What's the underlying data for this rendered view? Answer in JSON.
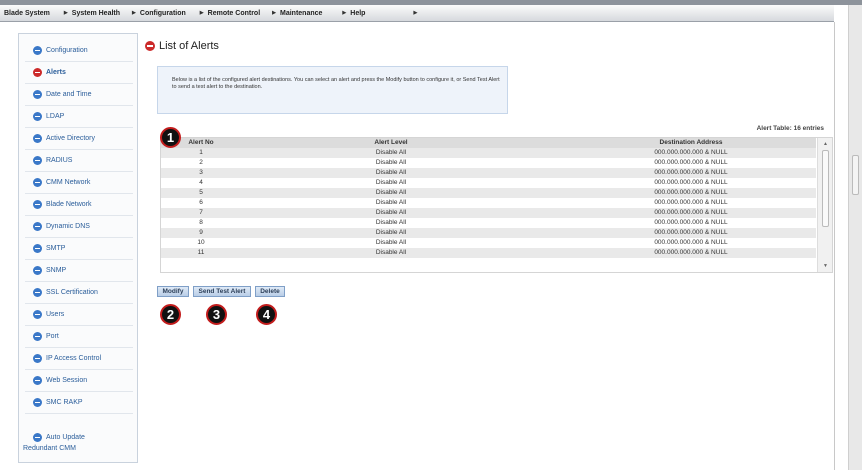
{
  "menu": {
    "items": [
      {
        "label": "Blade System"
      },
      {
        "label": "System Health"
      },
      {
        "label": "Configuration"
      },
      {
        "label": "Remote Control"
      },
      {
        "label": "Maintenance"
      },
      {
        "label": "Help"
      }
    ]
  },
  "sidebar": {
    "items": [
      {
        "label": "Configuration",
        "icon": "blue-circle-icon",
        "color": "#3a78c8"
      },
      {
        "label": "Alerts",
        "icon": "red-circle-icon",
        "color": "#cc2a2a",
        "selected": true
      },
      {
        "label": "Date and Time",
        "icon": "blue-circle-icon",
        "color": "#3a78c8"
      },
      {
        "label": "LDAP",
        "icon": "blue-circle-icon",
        "color": "#3a78c8"
      },
      {
        "label": "Active Directory",
        "icon": "blue-circle-icon",
        "color": "#3a78c8"
      },
      {
        "label": "RADIUS",
        "icon": "blue-circle-icon",
        "color": "#3a78c8"
      },
      {
        "label": "CMM Network",
        "icon": "blue-circle-icon",
        "color": "#3a78c8"
      },
      {
        "label": "Blade Network",
        "icon": "blue-circle-icon",
        "color": "#3a78c8"
      },
      {
        "label": "Dynamic DNS",
        "icon": "blue-circle-icon",
        "color": "#3a78c8"
      },
      {
        "label": "SMTP",
        "icon": "blue-circle-icon",
        "color": "#3a78c8"
      },
      {
        "label": "SNMP",
        "icon": "blue-circle-icon",
        "color": "#3a78c8"
      },
      {
        "label": "SSL Certification",
        "icon": "blue-circle-icon",
        "color": "#3a78c8"
      },
      {
        "label": "Users",
        "icon": "blue-circle-icon",
        "color": "#3a78c8"
      },
      {
        "label": "Port",
        "icon": "blue-circle-icon",
        "color": "#3a78c8"
      },
      {
        "label": "IP Access Control",
        "icon": "blue-circle-icon",
        "color": "#3a78c8"
      },
      {
        "label": "Web Session",
        "icon": "blue-circle-icon",
        "color": "#3a78c8"
      },
      {
        "label": "SMC RAKP",
        "icon": "blue-circle-icon",
        "color": "#3a78c8"
      },
      {
        "label": "Auto Update",
        "icon": "blue-circle-icon",
        "color": "#3a78c8"
      }
    ],
    "footer": "Redundant CMM"
  },
  "main": {
    "title": "List of Alerts",
    "title_icon_color": "#cc2a2a",
    "info": "Below is a list of the configured alert destinations. You can select an alert and press the Modify button to configure it, or Send Test Alert to send a test alert to the destination.",
    "table_count": "Alert Table: 16 entries",
    "columns": [
      "Alert No",
      "Alert Level",
      "Destination Address"
    ],
    "rows": [
      [
        "1",
        "Disable All",
        "000.000.000.000 & NULL"
      ],
      [
        "2",
        "Disable All",
        "000.000.000.000 & NULL"
      ],
      [
        "3",
        "Disable All",
        "000.000.000.000 & NULL"
      ],
      [
        "4",
        "Disable All",
        "000.000.000.000 & NULL"
      ],
      [
        "5",
        "Disable All",
        "000.000.000.000 & NULL"
      ],
      [
        "6",
        "Disable All",
        "000.000.000.000 & NULL"
      ],
      [
        "7",
        "Disable All",
        "000.000.000.000 & NULL"
      ],
      [
        "8",
        "Disable All",
        "000.000.000.000 & NULL"
      ],
      [
        "9",
        "Disable All",
        "000.000.000.000 & NULL"
      ],
      [
        "10",
        "Disable All",
        "000.000.000.000 & NULL"
      ],
      [
        "11",
        "Disable All",
        "000.000.000.000 & NULL"
      ]
    ],
    "buttons": {
      "modify": "Modify",
      "send_test": "Send Test Alert",
      "delete": "Delete"
    }
  },
  "callouts": [
    "1",
    "2",
    "3",
    "4"
  ]
}
